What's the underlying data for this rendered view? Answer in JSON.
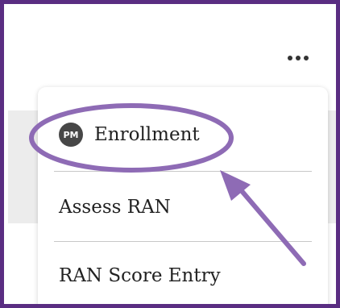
{
  "header": {
    "more_icon": "more-horizontal-icon"
  },
  "menu": {
    "items": [
      {
        "label": "Enrollment",
        "badge": "PM"
      },
      {
        "label": "Assess RAN"
      },
      {
        "label": "RAN Score Entry"
      }
    ]
  },
  "annotation": {
    "highlight_color": "#8e6bb5",
    "frame_color": "#5a2d82"
  }
}
